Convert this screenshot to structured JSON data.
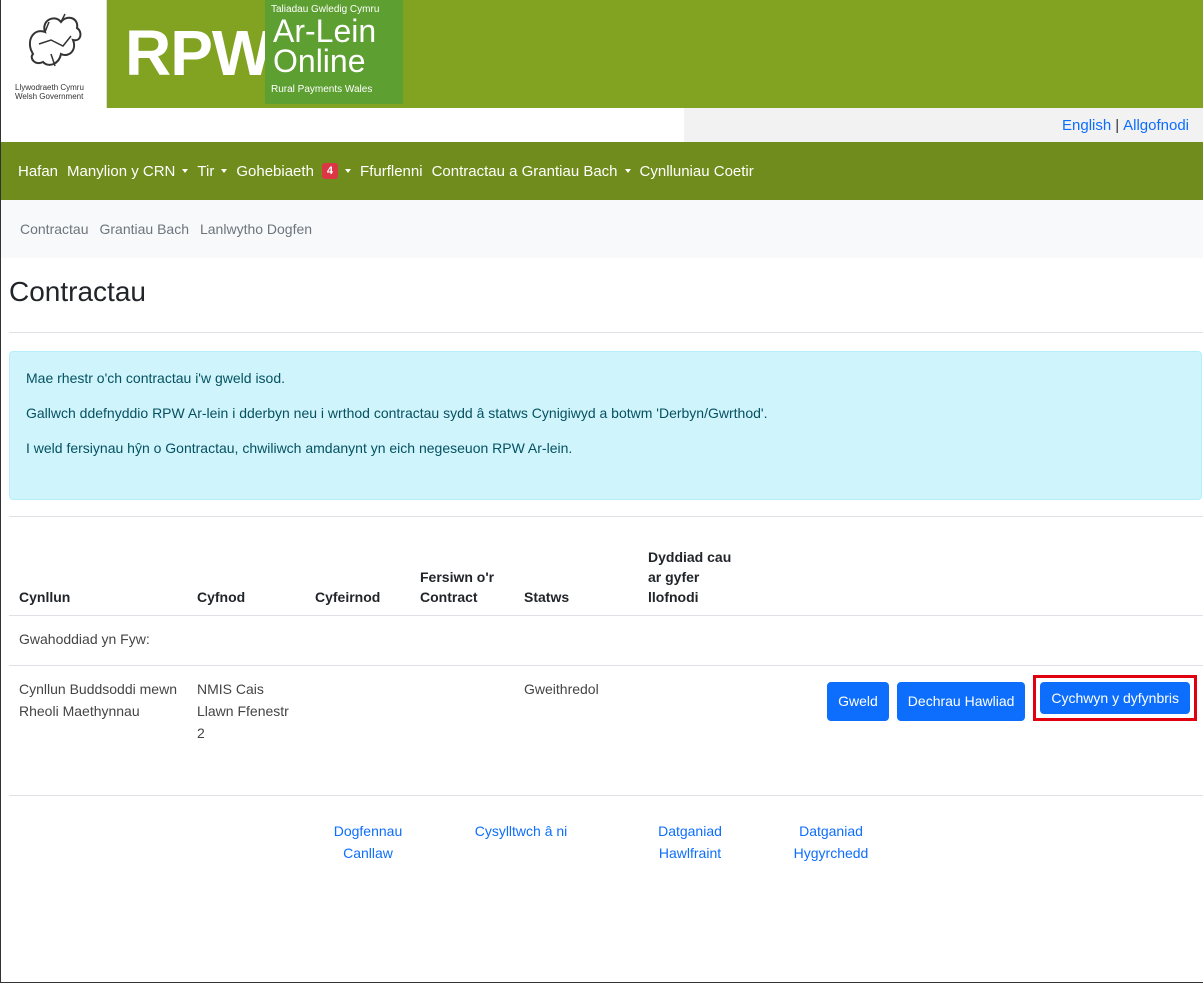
{
  "header": {
    "gov_line1": "Llywodraeth Cymru",
    "gov_line2": "Welsh Government",
    "rpw": "RPW",
    "online_small": "Taliadau Gwledig Cymru",
    "online_line1": "Ar-Lein",
    "online_line2": "Online",
    "online_foot": "Rural Payments Wales",
    "brand_green": "#82a321"
  },
  "lang": {
    "english": "English",
    "separator": "|",
    "logout": "Allgofnodi"
  },
  "nav": {
    "items": [
      "Hafan",
      "Manylion y CRN",
      "Tir",
      "Gohebiaeth",
      "Ffurflenni",
      "Contractau a Grantiau Bach",
      "Cynlluniau Coetir"
    ],
    "badge": "4",
    "color": "#6f8c1c"
  },
  "subnav": {
    "items": [
      "Contractau",
      "Grantiau Bach",
      "Lanlwytho Dogfen"
    ]
  },
  "page": {
    "title": "Contractau"
  },
  "alert": {
    "lines": [
      "Mae rhestr o'ch contractau i'w gweld isod.",
      "Gallwch ddefnyddio RPW Ar-lein i dderbyn neu i wrthod contractau sydd â statws Cynigiwyd a botwm 'Derbyn/Gwrthod'.",
      "I weld fersiynau hŷn o Gontractau, chwiliwch amdanynt yn eich negeseuon RPW Ar-lein."
    ]
  },
  "table": {
    "headers": [
      "Cynllun",
      "Cyfnod",
      "Cyfeirnod",
      "Fersiwn o'r Contract",
      "Statws",
      "Dyddiad cau ar gyfer llofnodi"
    ],
    "group": "Gwahoddiad yn Fyw:",
    "row": {
      "scheme": "Cynllun Buddsoddi mewn Rheoli Maethynnau",
      "period": "NMIS Cais Llawn Ffenestr 2",
      "reference": "",
      "version": "",
      "status": "Gweithredol",
      "deadline": ""
    },
    "buttons": {
      "view": "Gweld",
      "claim": "Dechrau Hawliad",
      "start_cap": "Cychwyn y dyfynbris"
    }
  },
  "footer": {
    "links": [
      "Dogfennau Canllaw",
      "Cysylltwch â ni",
      "Datganiad Hawlfraint",
      "Datganiad Hygyrchedd"
    ]
  }
}
